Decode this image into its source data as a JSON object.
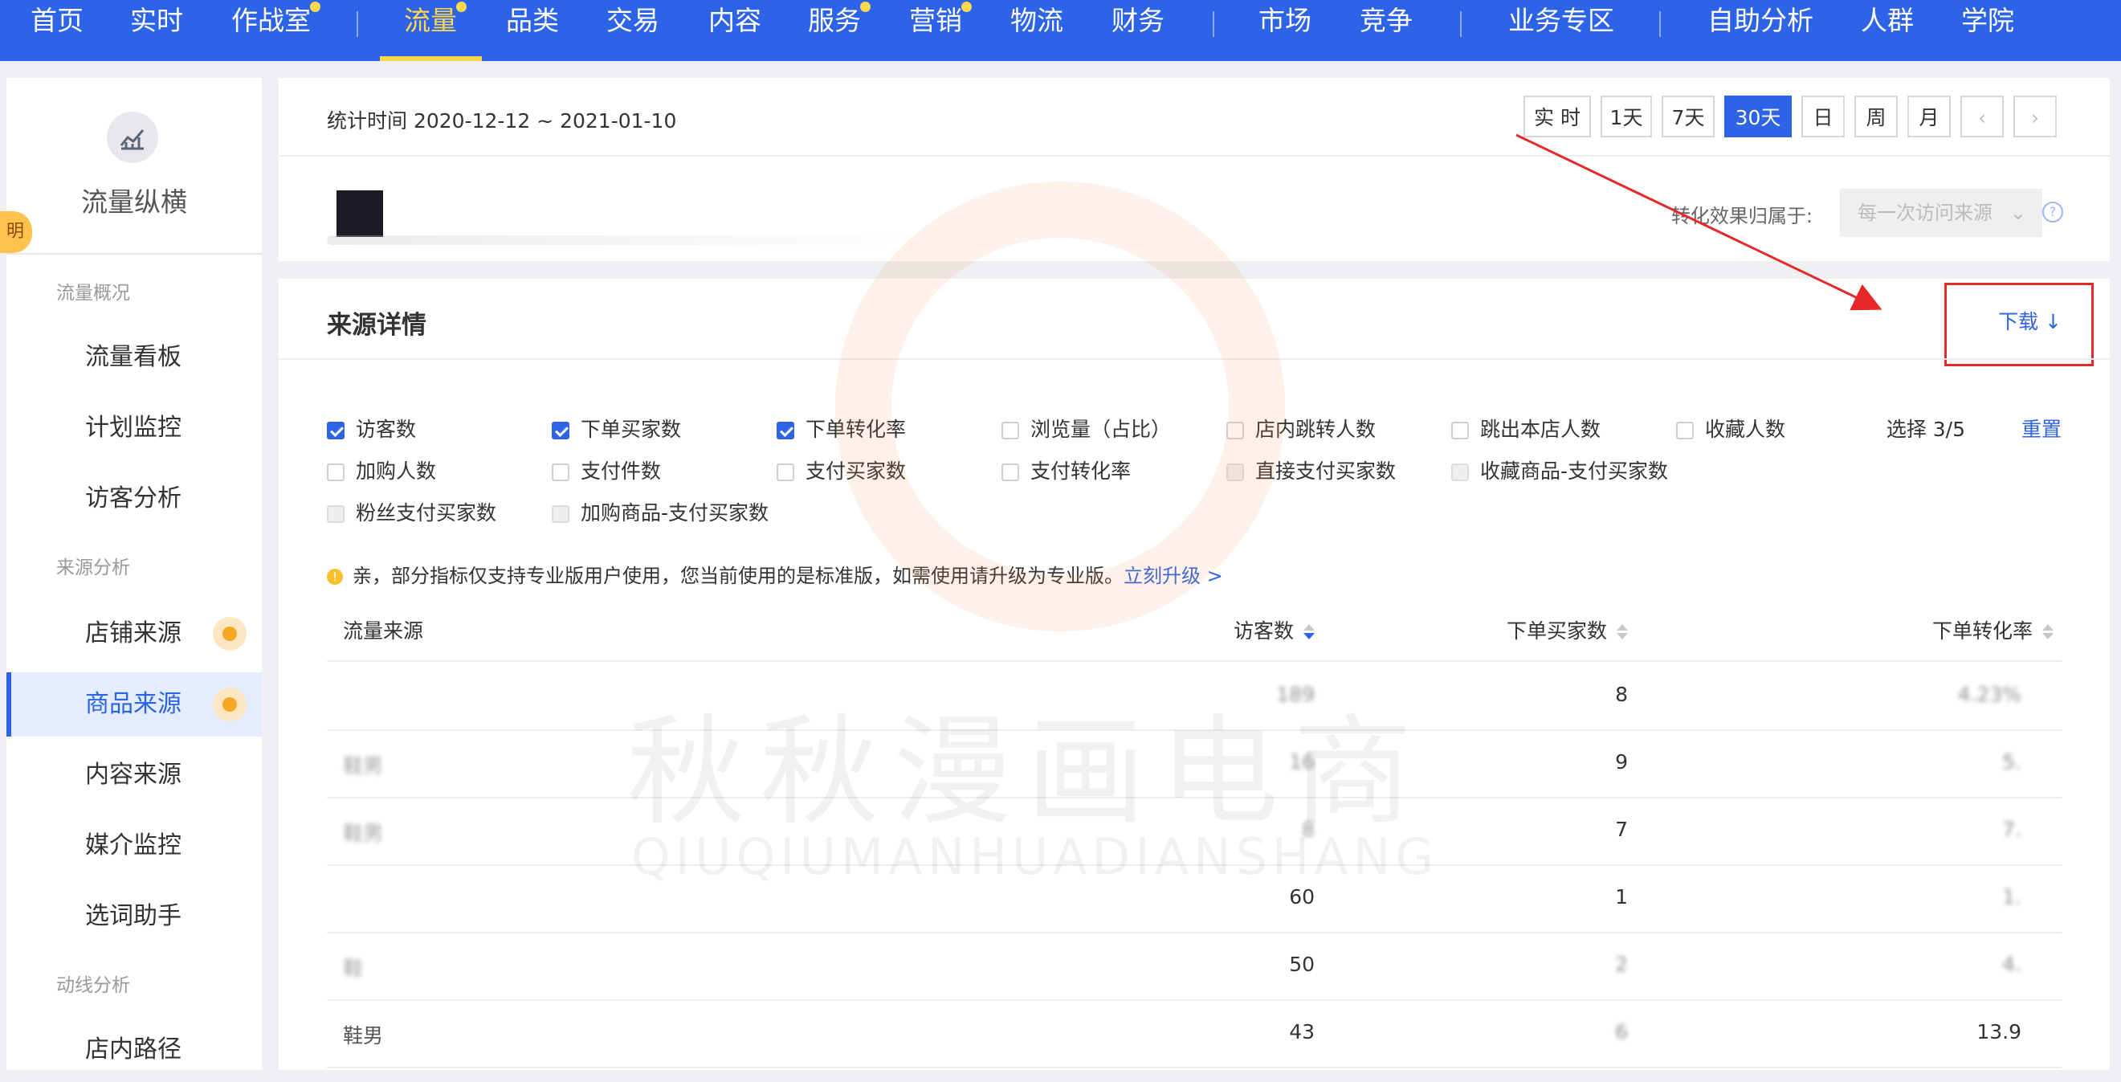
{
  "top_nav": {
    "items": [
      "首页",
      "实时",
      "作战室",
      "流量",
      "品类",
      "交易",
      "内容",
      "服务",
      "营销",
      "物流",
      "财务",
      "市场",
      "竞争",
      "业务专区",
      "自助分析",
      "人群",
      "学院"
    ],
    "active": "流量"
  },
  "sidebar": {
    "title": "流量纵横",
    "tab": "明",
    "groups": [
      "流量概况",
      "来源分析",
      "动线分析"
    ],
    "items": [
      "流量看板",
      "计划监控",
      "访客分析",
      "店铺来源",
      "商品来源",
      "内容来源",
      "媒介监控",
      "选词助手",
      "店内路径"
    ],
    "active": "商品来源"
  },
  "time_panel": {
    "stat_time": "统计时间 2020-12-12 ~ 2021-01-10",
    "ranges": [
      "实 时",
      "1天",
      "7天",
      "30天",
      "日",
      "周",
      "月"
    ],
    "active_range": "30天",
    "prev": "‹",
    "next": "›",
    "attribution_label": "转化效果归属于:",
    "attribution_value": "每一次访问来源",
    "attribution_chevron": "⌄",
    "help": "?"
  },
  "detail_panel": {
    "title": "来源详情",
    "download_label": "下载 ↓",
    "metrics": [
      {
        "label": "访客数",
        "state": "checked"
      },
      {
        "label": "下单买家数",
        "state": "checked"
      },
      {
        "label": "下单转化率",
        "state": "checked"
      },
      {
        "label": "浏览量（占比）",
        "state": "unchecked"
      },
      {
        "label": "店内跳转人数",
        "state": "unchecked"
      },
      {
        "label": "跳出本店人数",
        "state": "unchecked"
      },
      {
        "label": "收藏人数",
        "state": "unchecked"
      },
      {
        "label": "加购人数",
        "state": "unchecked"
      },
      {
        "label": "支付件数",
        "state": "unchecked"
      },
      {
        "label": "支付买家数",
        "state": "unchecked"
      },
      {
        "label": "支付转化率",
        "state": "unchecked"
      },
      {
        "label": "直接支付买家数",
        "state": "disabled"
      },
      {
        "label": "收藏商品-支付买家数",
        "state": "disabled"
      },
      {
        "label": "粉丝支付买家数",
        "state": "disabled"
      },
      {
        "label": "加购商品-支付买家数",
        "state": "disabled"
      }
    ],
    "select_count": "选择 3/5",
    "reset_label": "重置",
    "notice": "亲，部分指标仅支持专业版用户使用，您当前使用的是标准版，如需使用请升级为专业版。",
    "upgrade_label": "立刻升级 >"
  },
  "table": {
    "headers": [
      "流量来源",
      "访客数",
      "下单买家数",
      "下单转化率"
    ],
    "rows": [
      {
        "source": "",
        "visitors": "189",
        "buyers": "8",
        "rate": "4.23%"
      },
      {
        "source": "鞋男",
        "visitors": "16",
        "buyers": "9",
        "rate": "5."
      },
      {
        "source": "鞋男",
        "visitors": "8",
        "buyers": "7",
        "rate": "7."
      },
      {
        "source": "",
        "visitors": "60",
        "buyers": "1",
        "rate": "1."
      },
      {
        "source": "鞋",
        "visitors": "50",
        "buyers": "2",
        "rate": "4."
      },
      {
        "source": "鞋男",
        "visitors": "43",
        "buyers": "6",
        "rate": "13.9"
      }
    ]
  },
  "watermark": {
    "cn": "秋秋漫画电商",
    "en": "QIUQIUMANHUADIANSHANG"
  },
  "colors": {
    "nav_bg": "#2d63e6",
    "nav_active": "#ffd84d",
    "accent": "#2d63e6",
    "annotation": "#e52828",
    "badge": "#f7a623"
  }
}
